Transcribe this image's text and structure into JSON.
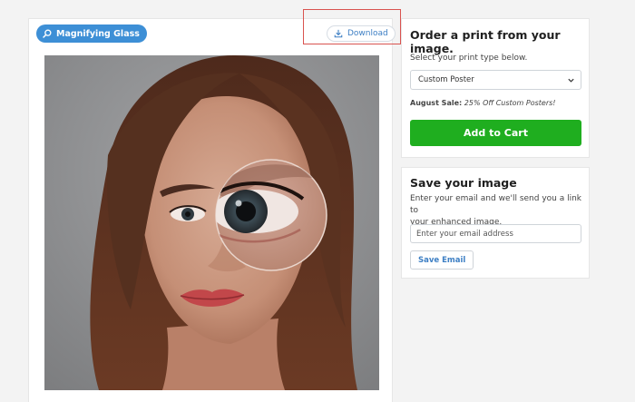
{
  "viewer": {
    "magnify_label": "Magnifying Glass",
    "download_label": "Download"
  },
  "order": {
    "title": "Order a print from your image.",
    "instruction": "Select your print type below.",
    "selected_print_type": "Custom Poster",
    "sale_label": "August Sale:",
    "sale_text": "25% Off Custom Posters!",
    "add_to_cart_label": "Add to Cart"
  },
  "save": {
    "title": "Save your image",
    "description_line1": "Enter your email and we'll send you a link to",
    "description_line2": "your enhanced image.",
    "email_placeholder": "Enter your email address",
    "email_value": "",
    "save_button_label": "Save Email"
  },
  "colors": {
    "magnify_button": "#3d8fd6",
    "download_text": "#3d7fc4",
    "add_to_cart": "#1fae1f",
    "highlight_box": "#d9534f"
  },
  "icons": {
    "magnify": "search-icon",
    "download": "download-icon",
    "select": "chevron-down-icon"
  }
}
